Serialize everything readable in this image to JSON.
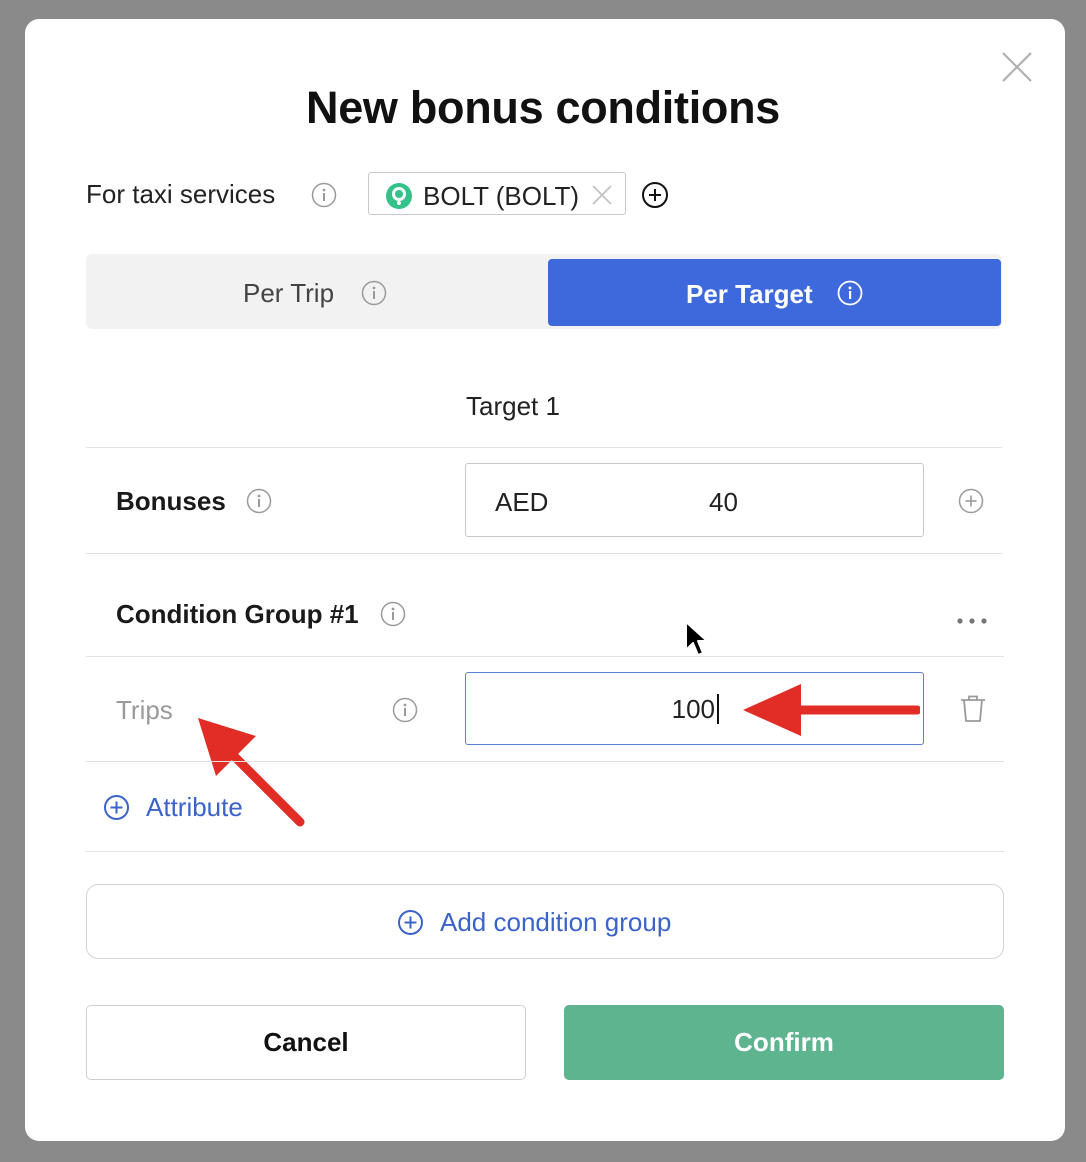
{
  "dialog": {
    "title": "New bonus conditions"
  },
  "services": {
    "label": "For taxi services",
    "chip_label": "BOLT (BOLT)"
  },
  "mode_tabs": {
    "per_trip": "Per Trip",
    "per_target": "Per Target",
    "selected": "Per Target"
  },
  "target": {
    "label": "Target 1"
  },
  "bonuses": {
    "label": "Bonuses",
    "currency": "AED",
    "amount": "40"
  },
  "condition_group": {
    "label": "Condition Group #1",
    "attribute_name": "Trips",
    "attribute_value": "100",
    "add_attribute_label": "Attribute"
  },
  "add_condition_group_label": "Add condition group",
  "actions": {
    "cancel": "Cancel",
    "confirm": "Confirm"
  },
  "colors": {
    "accent_blue": "#3d69dd",
    "confirm_green": "#5db48e",
    "annotation_red": "#e12d26",
    "link_blue": "#3b63c9"
  }
}
